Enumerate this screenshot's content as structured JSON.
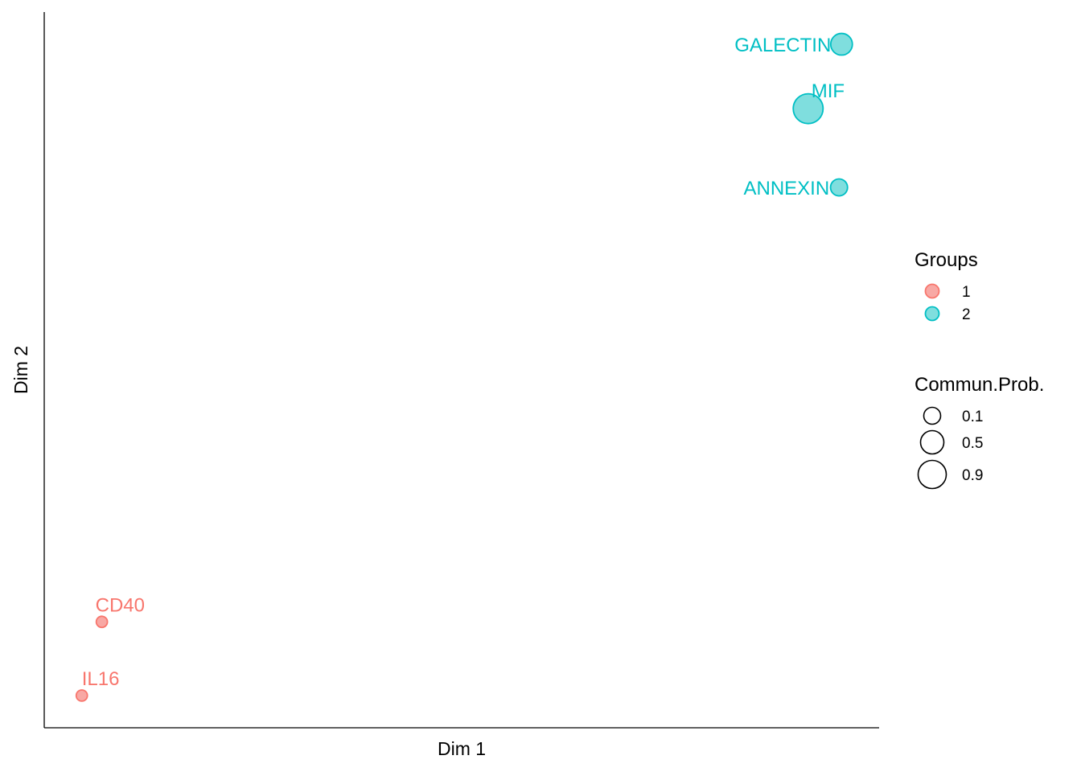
{
  "chart_data": {
    "type": "scatter",
    "xlabel": "Dim 1",
    "ylabel": "Dim 2",
    "grid": false,
    "legend_position": "right",
    "groups": [
      {
        "name": "1",
        "fill": "#F8A8A4",
        "stroke": "#F8766D"
      },
      {
        "name": "2",
        "fill": "#7FDEDE",
        "stroke": "#00BFC4"
      }
    ],
    "points": [
      {
        "label": "GALECTIN",
        "group": "2",
        "x": 0.955,
        "y": 0.955,
        "prob": 0.55
      },
      {
        "label": "MIF",
        "group": "2",
        "x": 0.915,
        "y": 0.865,
        "prob": 0.9
      },
      {
        "label": "ANNEXIN",
        "group": "2",
        "x": 0.952,
        "y": 0.755,
        "prob": 0.35
      },
      {
        "label": "CD40",
        "group": "1",
        "x": 0.069,
        "y": 0.148,
        "prob": 0.1
      },
      {
        "label": "IL16",
        "group": "1",
        "x": 0.045,
        "y": 0.045,
        "prob": 0.1
      }
    ],
    "legend": {
      "groups_title": "Groups",
      "size_title": "Commun.Prob.",
      "size_breaks": [
        {
          "label": "0.1",
          "value": 0.1
        },
        {
          "label": "0.5",
          "value": 0.5
        },
        {
          "label": "0.9",
          "value": 0.9
        }
      ]
    }
  }
}
